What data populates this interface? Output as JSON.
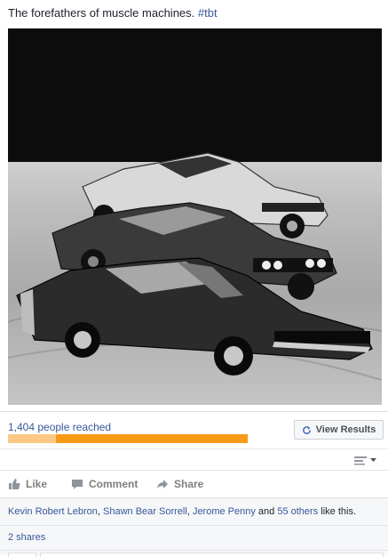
{
  "post": {
    "text": "The forefathers of muscle machines. ",
    "hashtag": "#tbt"
  },
  "insights": {
    "reach_label": "1,404 people reached",
    "reach_organic_fraction": 0.2,
    "view_results_label": "View Results",
    "colors": {
      "paid": "#f79a18",
      "organic": "#fbc985"
    }
  },
  "actions": {
    "like": {
      "label": "Like",
      "icon": "thumbs-up-icon"
    },
    "comment": {
      "label": "Comment",
      "icon": "comment-icon"
    },
    "share": {
      "label": "Share",
      "icon": "share-arrow-icon"
    }
  },
  "likes": {
    "people": [
      "Kevin Robert Lebron",
      "Shawn Bear Sorrell",
      "Jerome Penny"
    ],
    "sep1": ", ",
    "sep2": ", ",
    "and_text": " and ",
    "others": "55 others",
    "suffix": " like this."
  },
  "shares": {
    "label": "2 shares"
  }
}
